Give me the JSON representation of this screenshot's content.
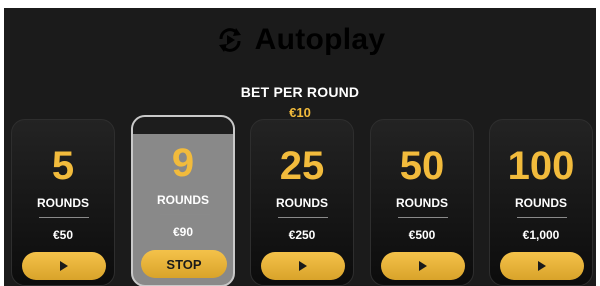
{
  "header": {
    "title": "Autoplay",
    "icon": "autoplay-cycle-icon"
  },
  "bet": {
    "label": "BET PER ROUND",
    "value": "€10"
  },
  "colors": {
    "accent": "#f2bb3c",
    "background": "#1b1b1b",
    "selected_card": "#898989"
  },
  "options": [
    {
      "rounds": "5",
      "rounds_label": "ROUNDS",
      "cost": "€50",
      "action": "play-icon"
    },
    {
      "rounds": "9",
      "rounds_label": "ROUNDS",
      "cost": "€90",
      "action_label": "STOP",
      "selected": true
    },
    {
      "rounds": "25",
      "rounds_label": "ROUNDS",
      "cost": "€250",
      "action": "play-icon"
    },
    {
      "rounds": "50",
      "rounds_label": "ROUNDS",
      "cost": "€500",
      "action": "play-icon"
    },
    {
      "rounds": "100",
      "rounds_label": "ROUNDS",
      "cost": "€1,000",
      "action": "play-icon"
    }
  ]
}
